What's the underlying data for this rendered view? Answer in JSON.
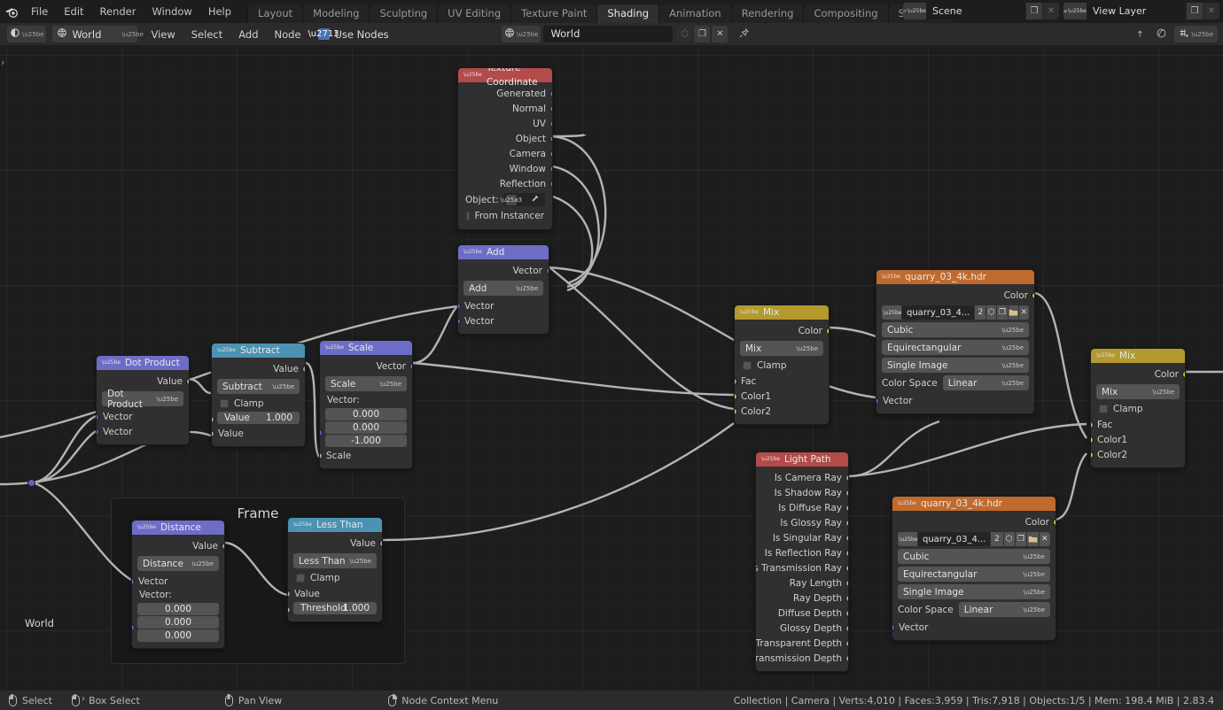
{
  "topbar": {
    "logo_icon": "blender-logo-icon",
    "menus": [
      "File",
      "Edit",
      "Render",
      "Window",
      "Help"
    ],
    "workspaces": [
      {
        "label": "Layout",
        "active": false
      },
      {
        "label": "Modeling",
        "active": false
      },
      {
        "label": "Sculpting",
        "active": false
      },
      {
        "label": "UV Editing",
        "active": false
      },
      {
        "label": "Texture Paint",
        "active": false
      },
      {
        "label": "Shading",
        "active": true
      },
      {
        "label": "Animation",
        "active": false
      },
      {
        "label": "Rendering",
        "active": false
      },
      {
        "label": "Compositing",
        "active": false
      },
      {
        "label": "Scripting",
        "active": false
      }
    ],
    "add_workspace_label": "+",
    "scene": {
      "icon": "scene-icon",
      "name": "Scene",
      "new_label": "❐",
      "unlink_label": "✕"
    },
    "view_layer": {
      "icon": "view-layer-icon",
      "name": "View Layer",
      "new_label": "❐",
      "unlink_label": "✕"
    }
  },
  "editor_header": {
    "editor_type_icon": "shader-editor-icon",
    "shader_type": {
      "icon": "world-icon",
      "label": "World"
    },
    "menus": [
      "View",
      "Select",
      "Add",
      "Node"
    ],
    "use_nodes": {
      "label": "Use Nodes",
      "checked": true
    },
    "datablock": {
      "icon": "world-icon",
      "name": "World",
      "fake_user_label": "⬡",
      "new_label": "❐",
      "unlink_label": "✕"
    },
    "pin_label": "📌",
    "right_icons": [
      "snap-to-node-icon",
      "proportional-edit-icon",
      "snapping-icon"
    ]
  },
  "canvas": {
    "breadcrumb": "World",
    "sidebar_toggle": "›",
    "frame_label": "Frame"
  },
  "nodes": {
    "texture_coordinate": {
      "title": "Texture Coordinate",
      "header_color": "#b34b4b",
      "outputs": [
        "Generated",
        "Normal",
        "UV",
        "Object",
        "Camera",
        "Window",
        "Reflection"
      ],
      "object_label": "Object:",
      "object_value": "",
      "from_instancer_label": "From Instancer"
    },
    "add_vector": {
      "title": "Add",
      "header_color": "#6d6dc8",
      "output": "Vector",
      "operation": "Add",
      "inputs": [
        "Vector",
        "Vector"
      ]
    },
    "dot_product": {
      "title": "Dot Product",
      "header_color": "#6d6dc8",
      "output": "Value",
      "operation": "Dot Product",
      "inputs": [
        "Vector",
        "Vector"
      ]
    },
    "subtract": {
      "title": "Subtract",
      "header_color": "#4b92b3",
      "output": "Value",
      "operation": "Subtract",
      "clamp_label": "Clamp",
      "value_label": "Value",
      "value_number": "1.000",
      "input_label": "Value"
    },
    "scale": {
      "title": "Scale",
      "header_color": "#6d6dc8",
      "output": "Vector",
      "operation": "Scale",
      "vector_label": "Vector:",
      "vector_values": [
        "0.000",
        "0.000",
        "-1.000"
      ],
      "scale_input_label": "Scale"
    },
    "mix_center": {
      "title": "Mix",
      "header_color": "#b3992e",
      "output": "Color",
      "blend_mode": "Mix",
      "clamp_label": "Clamp",
      "inputs": [
        "Fac",
        "Color1",
        "Color2"
      ]
    },
    "env_top": {
      "title": "quarry_03_4k.hdr",
      "header_color": "#c06a2e",
      "output": "Color",
      "image_name": "quarry_03_4...",
      "users_count": "2",
      "fake_user_label": "⬡",
      "new_label": "❐",
      "open_label": "🗀",
      "unlink_label": "✕",
      "interpolation": "Cubic",
      "projection": "Equirectangular",
      "source": "Single Image",
      "color_space_label": "Color Space",
      "color_space": "Linear",
      "input": "Vector"
    },
    "env_bottom": {
      "title": "quarry_03_4k.hdr",
      "header_color": "#c06a2e",
      "output": "Color",
      "image_name": "quarry_03_4...",
      "users_count": "2",
      "fake_user_label": "⬡",
      "new_label": "❐",
      "open_label": "🗀",
      "unlink_label": "✕",
      "interpolation": "Cubic",
      "projection": "Equirectangular",
      "source": "Single Image",
      "color_space_label": "Color Space",
      "color_space": "Linear",
      "input": "Vector"
    },
    "light_path": {
      "title": "Light Path",
      "header_color": "#b34b4b",
      "outputs": [
        "Is Camera Ray",
        "Is Shadow Ray",
        "Is Diffuse Ray",
        "Is Glossy Ray",
        "Is Singular Ray",
        "Is Reflection Ray",
        "Is Transmission Ray",
        "Ray Length",
        "Ray Depth",
        "Diffuse Depth",
        "Glossy Depth",
        "Transparent Depth",
        "Transmission Depth"
      ]
    },
    "mix_right": {
      "title": "Mix",
      "header_color": "#b3992e",
      "output": "Color",
      "blend_mode": "Mix",
      "clamp_label": "Clamp",
      "inputs": [
        "Fac",
        "Color1",
        "Color2"
      ]
    },
    "distance": {
      "title": "Distance",
      "header_color": "#6d6dc8",
      "output": "Value",
      "operation": "Distance",
      "input_vector": "Vector",
      "vector_label": "Vector:",
      "vector_values": [
        "0.000",
        "0.000",
        "0.000"
      ]
    },
    "less_than": {
      "title": "Less Than",
      "header_color": "#4b92b3",
      "output": "Value",
      "operation": "Less Than",
      "clamp_label": "Clamp",
      "input_label": "Value",
      "threshold_label": "Threshold",
      "threshold_value": "1.000"
    }
  },
  "statusbar": {
    "items": [
      {
        "icon": "mouse-left-icon",
        "label": "Select"
      },
      {
        "icon": "mouse-left-drag-icon",
        "label": "Box Select"
      },
      {
        "icon": "mouse-middle-icon",
        "label": "Pan View"
      },
      {
        "icon": "mouse-right-icon",
        "label": "Node Context Menu"
      }
    ],
    "stats": "Collection | Camera | Verts:4,010 | Faces:3,959 | Tris:7,918 | Objects:1/5 | Mem: 198.4 MiB | 2.83.4"
  }
}
